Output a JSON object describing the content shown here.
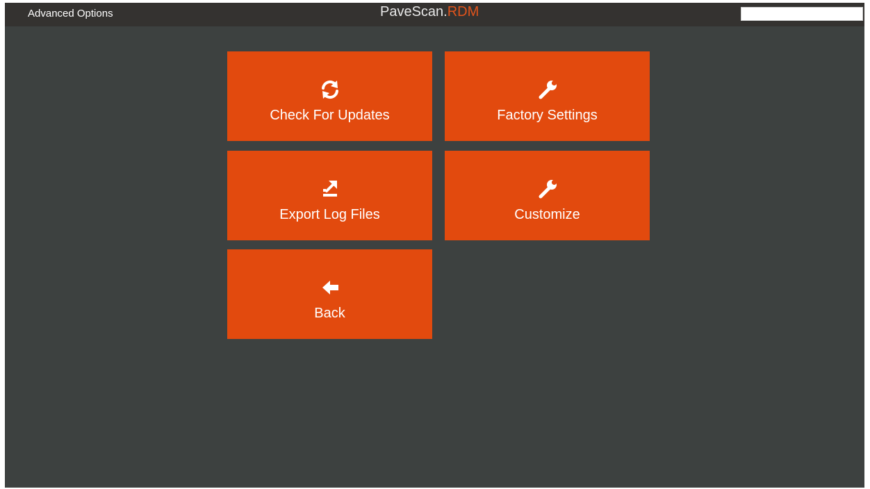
{
  "header": {
    "screen_title": "Advanced Options",
    "brand_main": "PaveScan",
    "brand_separator": ".",
    "brand_accent": "RDM"
  },
  "menu": {
    "tiles": [
      {
        "label": "Check For Updates",
        "icon": "refresh-icon"
      },
      {
        "label": "Factory Settings",
        "icon": "wrench-icon"
      },
      {
        "label": "Export Log Files",
        "icon": "export-icon"
      },
      {
        "label": "Customize",
        "icon": "wrench-icon"
      },
      {
        "label": "Back",
        "icon": "arrow-left-icon"
      }
    ]
  },
  "colors": {
    "background": "#3d4140",
    "topbar": "#343230",
    "tile": "#e24a0e",
    "brand_accent": "#e2541c"
  }
}
